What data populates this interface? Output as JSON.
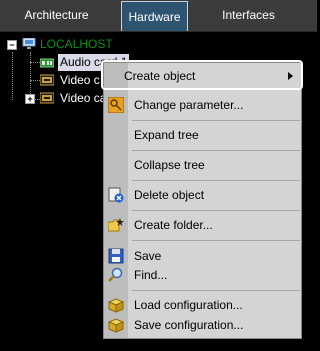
{
  "tabs": [
    {
      "label": "Architecture"
    },
    {
      "label": "Hardware"
    },
    {
      "label": "Interfaces"
    }
  ],
  "tree": {
    "root": {
      "label": "LOCALHOST"
    },
    "children": [
      {
        "label": "Audio card 1"
      },
      {
        "label": "Video c"
      },
      {
        "label": "Video ca"
      }
    ]
  },
  "menu": {
    "items": [
      {
        "label": "Create object"
      },
      {
        "label": "Change parameter..."
      },
      {
        "label": "Expand tree"
      },
      {
        "label": "Collapse tree"
      },
      {
        "label": "Delete object"
      },
      {
        "label": "Create folder..."
      },
      {
        "label": "Save"
      },
      {
        "label": "Find..."
      },
      {
        "label": "Load configuration..."
      },
      {
        "label": "Save configuration..."
      }
    ]
  },
  "colors": {
    "active_tab": "#2f5470",
    "host_text": "#138d18",
    "menu_bg": "#d4d4d4",
    "selection": "#d9d9e8"
  }
}
